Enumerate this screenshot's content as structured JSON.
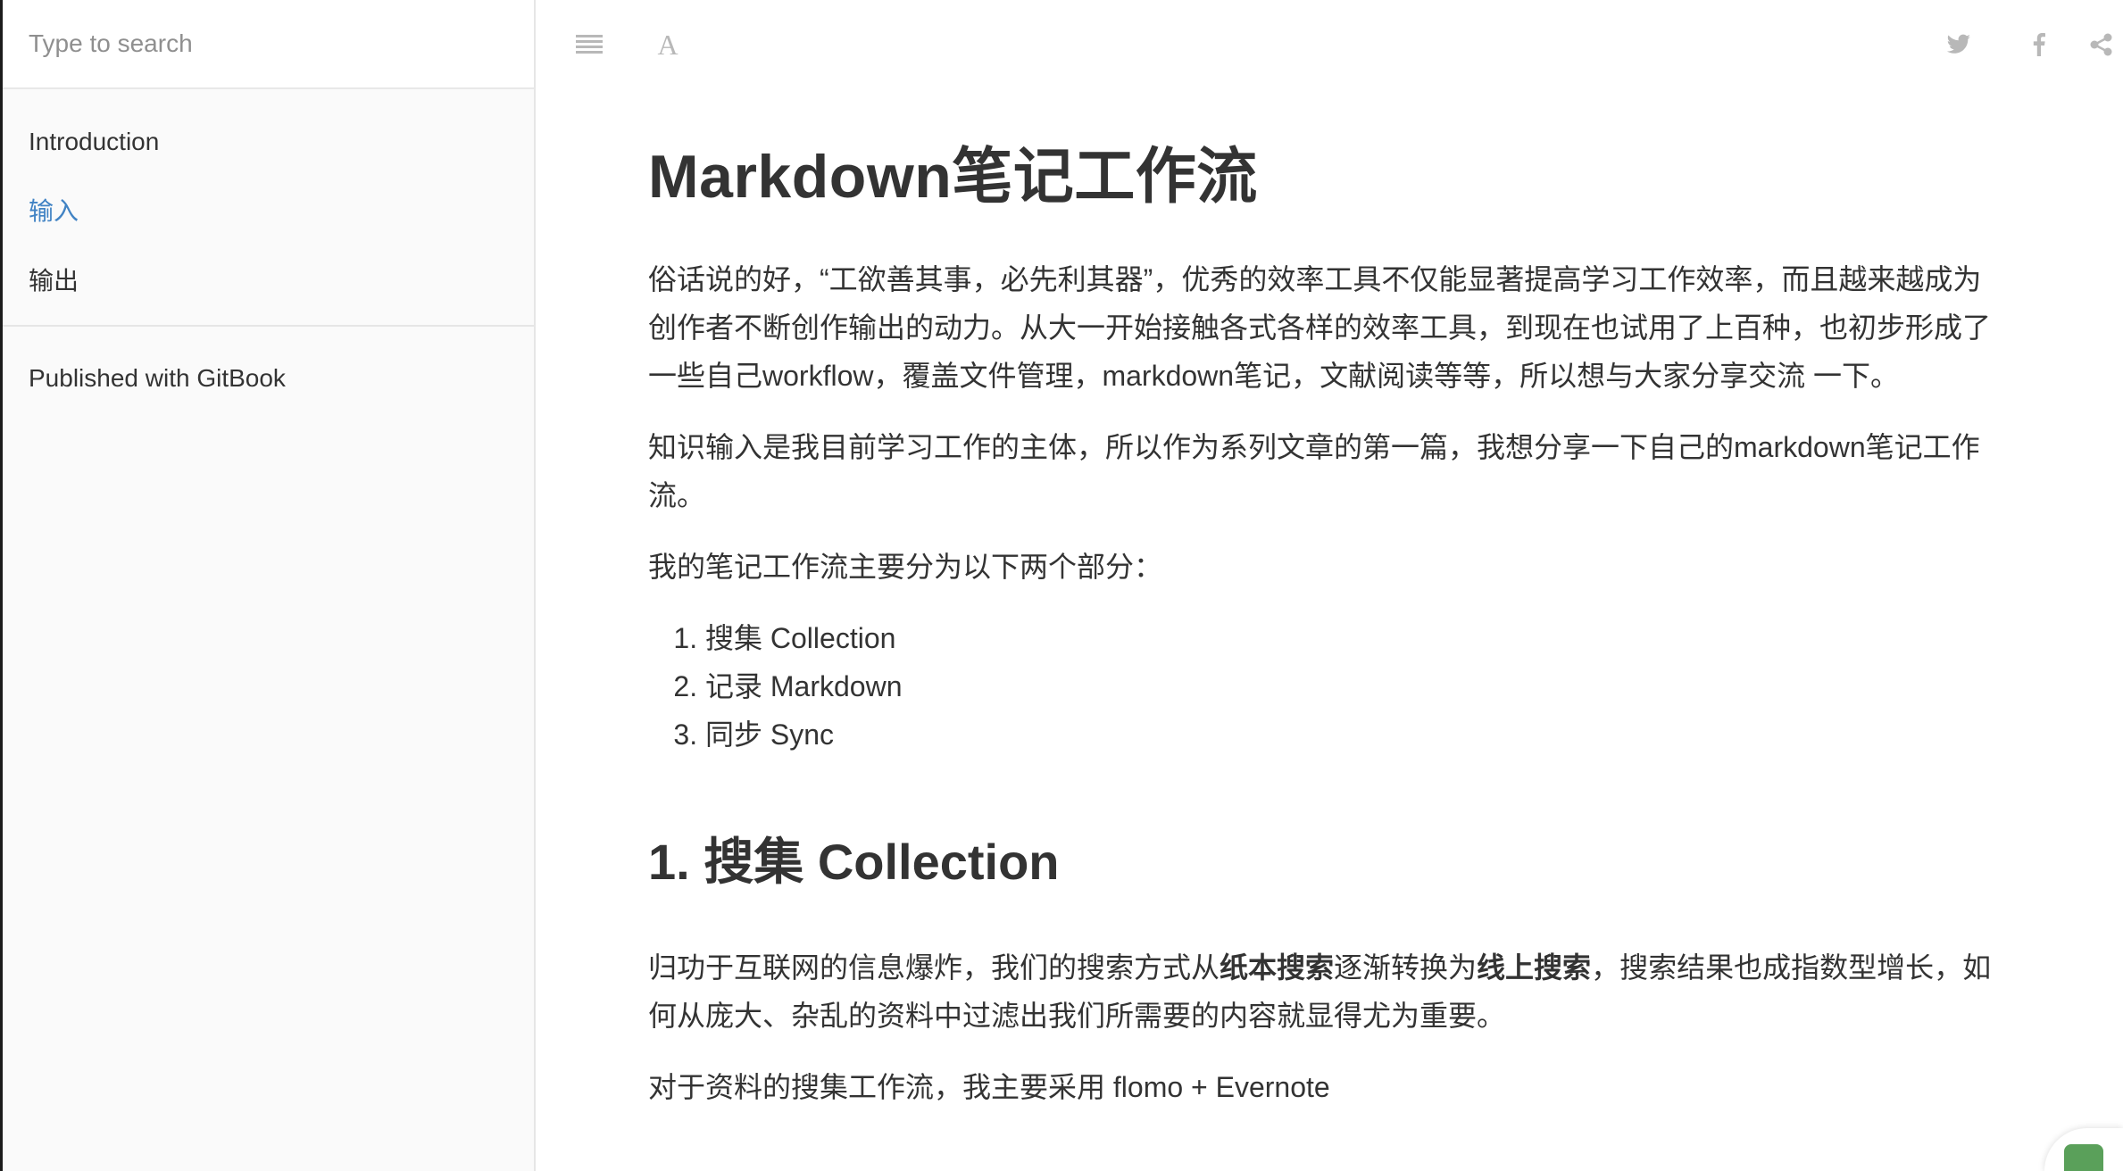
{
  "search": {
    "placeholder": "Type to search"
  },
  "sidebar": {
    "items": [
      {
        "label": "Introduction",
        "active": false
      },
      {
        "label": "输入",
        "active": true
      },
      {
        "label": "输出",
        "active": false
      }
    ],
    "published_label": "Published with GitBook"
  },
  "toolbar": {
    "menu_icon": "list-icon",
    "font_icon": "font-settings-icon",
    "font_glyph": "A",
    "share_icons": [
      "twitter-icon",
      "facebook-icon",
      "share-icon"
    ]
  },
  "colors": {
    "accent": "#4183c4",
    "text": "#333333",
    "sidebar_bg": "#fafafa",
    "icon_gray": "#b8b8b8"
  },
  "article": {
    "title": "Markdown笔记工作流",
    "para1": "俗话说的好，“工欲善其事，必先利其器”，优秀的效率工具不仅能显著提高学习工作效率，而且越来越成为创作者不断创作输出的动力。从大一开始接触各式各样的效率工具，到现在也试用了上百种，也初步形成了一些自己workflow，覆盖文件管理，markdown笔记，文献阅读等等，所以想与大家分享交流 一下。",
    "para2": "知识输入是我目前学习工作的主体，所以作为系列文章的第一篇，我想分享一下自己的markdown笔记工作流。",
    "para3": "我的笔记工作流主要分为以下两个部分：",
    "list": [
      "搜集 Collection",
      "记录 Markdown",
      "同步 Sync"
    ],
    "section1_title": "1. 搜集 Collection",
    "para4_a": "归功于互联网的信息爆炸，我们的搜索方式从",
    "para4_b": "纸本搜索",
    "para4_c": "逐渐转换为",
    "para4_d": "线上搜索",
    "para4_e": "，搜索结果也成指数型增长，如何从庞大、杂乱的资料中过滤出我们所需要的内容就显得尤为重要。",
    "para5": "对于资料的搜集工作流，我主要采用 flomo + Evernote"
  }
}
